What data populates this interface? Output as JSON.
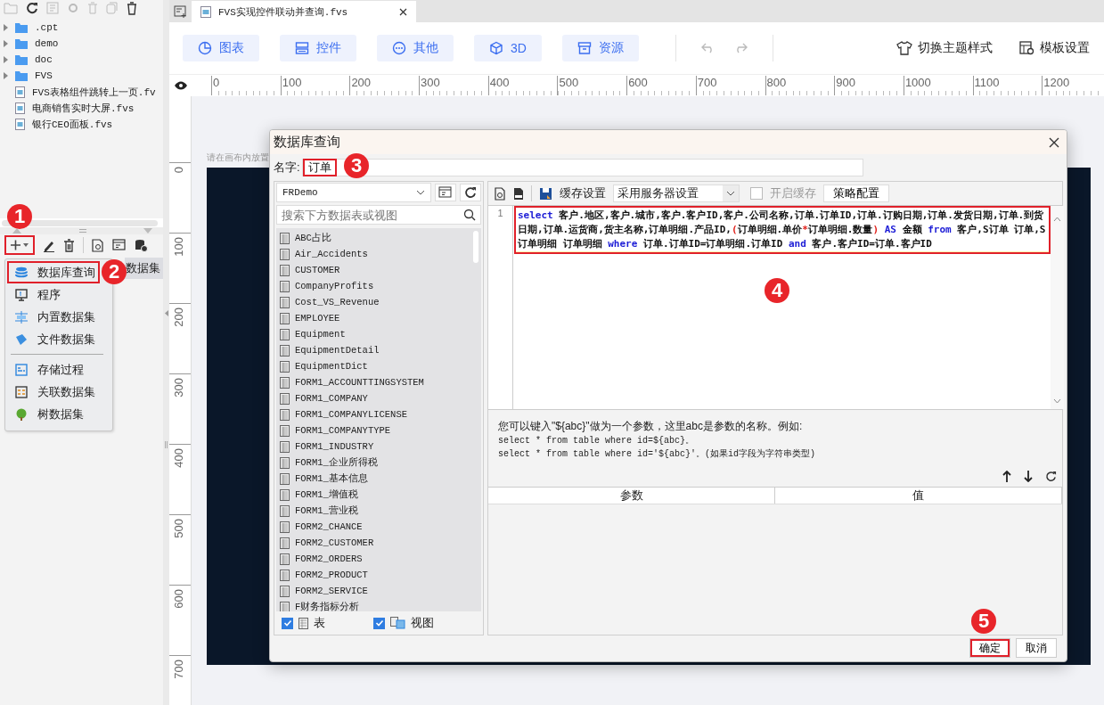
{
  "file_tree": [
    {
      "name": ".cpt",
      "kind": "folder"
    },
    {
      "name": "demo",
      "kind": "folder"
    },
    {
      "name": "doc",
      "kind": "folder"
    },
    {
      "name": "FVS",
      "kind": "folder"
    },
    {
      "name": "FVS表格组件跳转上一页.fv",
      "kind": "file"
    },
    {
      "name": "电商销售实时大屏.fvs",
      "kind": "file"
    },
    {
      "name": "银行CEO面板.fvs",
      "kind": "file"
    }
  ],
  "dataset_toolbar": {
    "add_highlighted": true
  },
  "dataset_list": [
    {
      "label": "数据集",
      "selected": true
    }
  ],
  "add_menu": {
    "groups": [
      [
        {
          "label": "数据库查询",
          "kind": "database",
          "highlighted": true
        },
        {
          "label": "程序",
          "kind": "program",
          "highlighted": false
        },
        {
          "label": "内置数据集",
          "kind": "embedded",
          "highlighted": false
        },
        {
          "label": "文件数据集",
          "kind": "file",
          "highlighted": false
        }
      ],
      [
        {
          "label": "存储过程",
          "kind": "procedure",
          "highlighted": false
        },
        {
          "label": "关联数据集",
          "kind": "relation",
          "highlighted": false
        },
        {
          "label": "树数据集",
          "kind": "tree",
          "highlighted": false
        }
      ]
    ]
  },
  "editor_tab": {
    "title": "FVS实现控件联动并查询.fvs"
  },
  "toolbar": {
    "buttons": [
      {
        "label": "图表",
        "kind": "chart"
      },
      {
        "label": "控件",
        "kind": "widget"
      },
      {
        "label": "其他",
        "kind": "more"
      },
      {
        "label": "3D",
        "kind": "cube"
      },
      {
        "label": "资源",
        "kind": "box"
      }
    ],
    "right": [
      {
        "label": "切换主题样式",
        "kind": "theme"
      },
      {
        "label": "模板设置",
        "kind": "template"
      }
    ]
  },
  "ruler": {
    "x_labels": [
      "0",
      "100",
      "200",
      "300",
      "400",
      "500",
      "600",
      "700",
      "800",
      "900",
      "1000",
      "1100",
      "1200"
    ],
    "y_labels": [
      "0",
      "100",
      "200",
      "300",
      "400",
      "500",
      "600",
      "700"
    ]
  },
  "canvas": {
    "hint": "请在画布内放置"
  },
  "dialog": {
    "title": "数据库查询",
    "name_label": "名字:",
    "name_value": "订单",
    "name_highlighted": true,
    "datasource": "FRDemo",
    "search_placeholder": "搜索下方数据表或视图",
    "tables": [
      "ABC占比",
      "Air_Accidents",
      "CUSTOMER",
      "CompanyProfits",
      "Cost_VS_Revenue",
      "EMPLOYEE",
      "Equipment",
      "EquipmentDetail",
      "EquipmentDict",
      "FORM1_ACCOUNTTINGSYSTEM",
      "FORM1_COMPANY",
      "FORM1_COMPANYLICENSE",
      "FORM1_COMPANYTYPE",
      "FORM1_INDUSTRY",
      "FORM1_企业所得税",
      "FORM1_基本信息",
      "FORM1_增值税",
      "FORM1_营业税",
      "FORM2_CHANCE",
      "FORM2_CUSTOMER",
      "FORM2_ORDERS",
      "FORM2_PRODUCT",
      "FORM2_SERVICE",
      "F财务指标分析"
    ],
    "filters": [
      {
        "label": "表",
        "checked": true,
        "kind": "table"
      },
      {
        "label": "视图",
        "checked": true,
        "kind": "view"
      }
    ],
    "cache_label": "缓存设置",
    "cache_mode": "采用服务器设置",
    "cache_enable": {
      "label": "开启缓存",
      "checked": false,
      "disabled": true
    },
    "strategy_button": "策略配置",
    "line_number": "1",
    "sql_highlighted": true,
    "sql": [
      {
        "text": "select",
        "kind": "keyword"
      },
      {
        "text": " 客户.地区,客户.城市,客户.客户ID,客户.公司名称,订单.订单ID,订单.订购日期,订单.发货日期,订单.到货日期,订单.运货商,货主名称,订单明细.产品ID,",
        "kind": "plain"
      },
      {
        "text": "(",
        "kind": "paren"
      },
      {
        "text": "订单明细.单价",
        "kind": "plain"
      },
      {
        "text": "*",
        "kind": "paren"
      },
      {
        "text": "订单明细.数量",
        "kind": "plain"
      },
      {
        "text": ")",
        "kind": "paren"
      },
      {
        "text": " AS",
        "kind": "keyword"
      },
      {
        "text": " 金额 ",
        "kind": "plain"
      },
      {
        "text": "from",
        "kind": "keyword"
      },
      {
        "text": " 客户,S订单 订单,S订单明细 订单明细 ",
        "kind": "plain"
      },
      {
        "text": "where",
        "kind": "keyword"
      },
      {
        "text": " 订单.订单ID=订单明细.订单ID ",
        "kind": "plain"
      },
      {
        "text": "and",
        "kind": "keyword"
      },
      {
        "text": " 客户.客户ID=订单.客户ID",
        "kind": "plain"
      }
    ],
    "hint_lines": [
      "您可以键入\"${abc}\"做为一个参数，这里abc是参数的名称。例如:",
      "select * from table where id=${abc}。",
      "select * from table where id='${abc}'。(如果id字段为字符串类型)"
    ],
    "param_columns": [
      "参数",
      "值"
    ],
    "ok_button": "确定",
    "ok_highlighted": true,
    "cancel_button": "取消"
  },
  "callouts": [
    "1",
    "2",
    "3",
    "4",
    "5"
  ]
}
